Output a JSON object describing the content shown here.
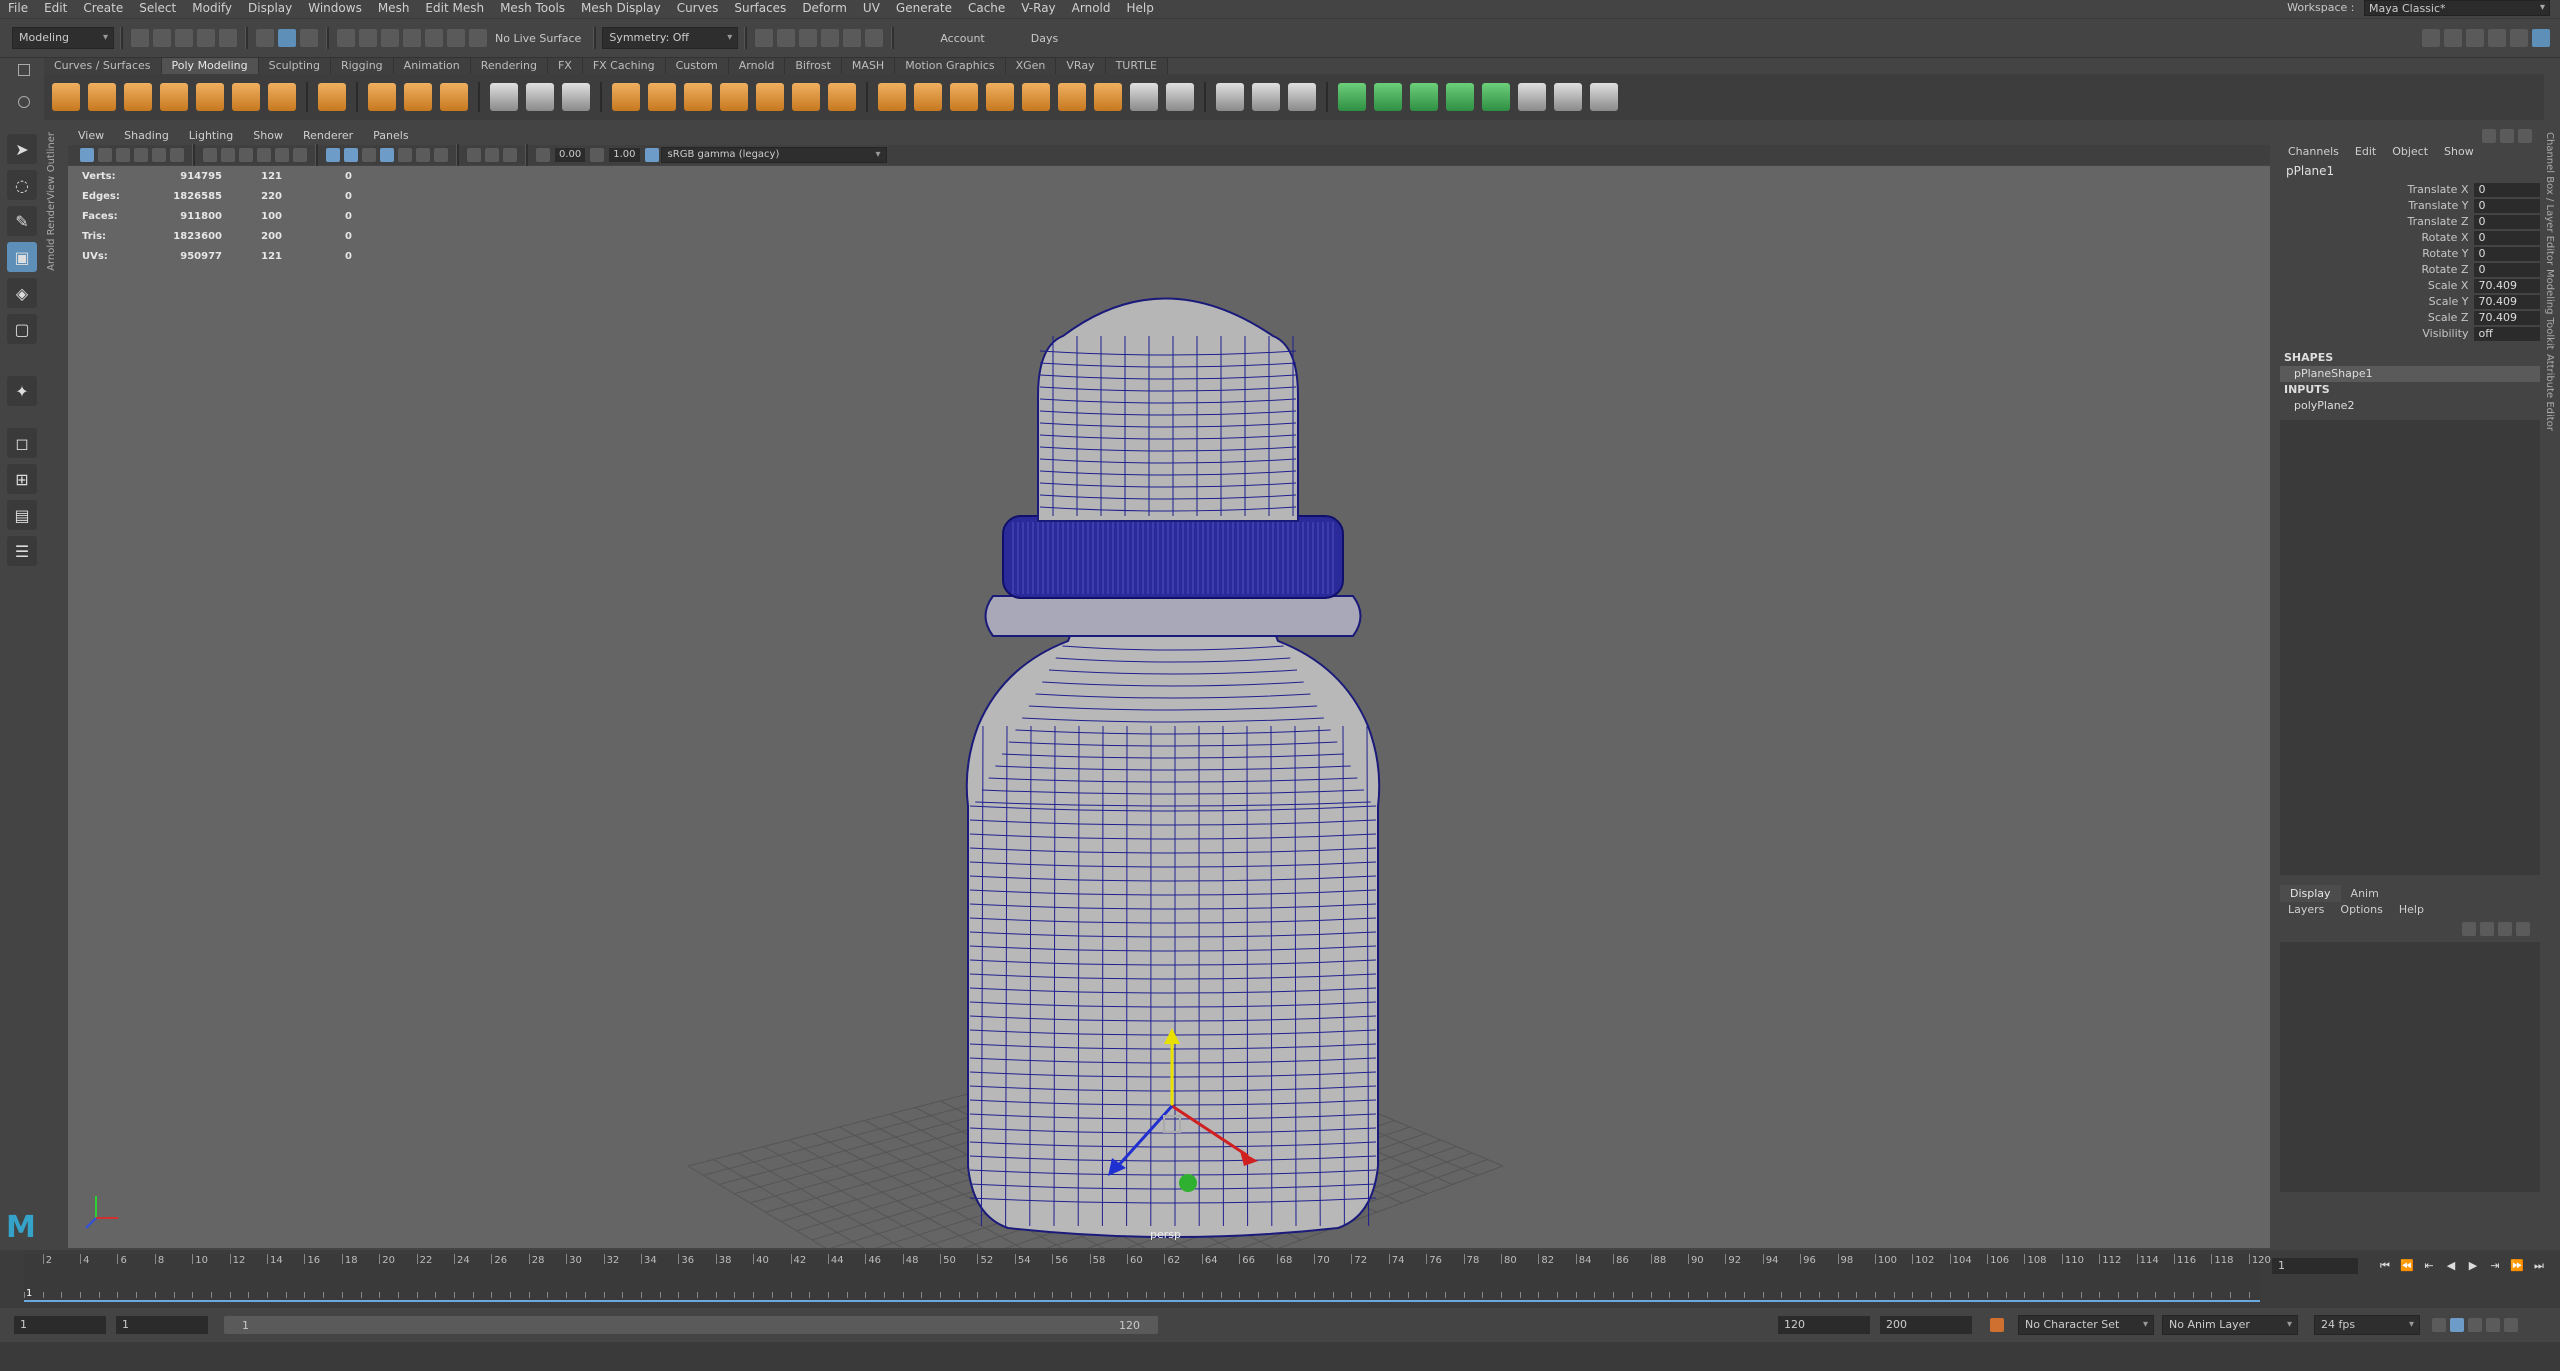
{
  "menubar": {
    "items": [
      "File",
      "Edit",
      "Create",
      "Select",
      "Modify",
      "Display",
      "Windows",
      "Mesh",
      "Edit Mesh",
      "Mesh Tools",
      "Mesh Display",
      "Curves",
      "Surfaces",
      "Deform",
      "UV",
      "Generate",
      "Cache",
      "V-Ray",
      "Arnold",
      "Help"
    ],
    "workspace_label": "Workspace :",
    "workspace_value": "Maya Classic*"
  },
  "statusline": {
    "mode": "Modeling",
    "live_surface": "No Live Surface",
    "symmetry": "Symmetry: Off",
    "account": "Account",
    "days": "Days"
  },
  "shelf": {
    "tabs": [
      "Curves / Surfaces",
      "Poly Modeling",
      "Sculpting",
      "Rigging",
      "Animation",
      "Rendering",
      "FX",
      "FX Caching",
      "Custom",
      "Arnold",
      "Bifrost",
      "MASH",
      "Motion Graphics",
      "XGen",
      "VRay",
      "TURTLE"
    ],
    "active_tab": "Poly Modeling"
  },
  "sidetabs": [
    "Outliner",
    "Arnold RenderView"
  ],
  "viewport": {
    "menu": [
      "View",
      "Shading",
      "Lighting",
      "Show",
      "Renderer",
      "Panels"
    ],
    "exposure": "0.00",
    "gamma": "1.00",
    "color_space": "sRGB gamma (legacy)",
    "camera": "persp",
    "hud": [
      {
        "label": "Verts:",
        "a": "914795",
        "b": "121",
        "c": "0"
      },
      {
        "label": "Edges:",
        "a": "1826585",
        "b": "220",
        "c": "0"
      },
      {
        "label": "Faces:",
        "a": "911800",
        "b": "100",
        "c": "0"
      },
      {
        "label": "Tris:",
        "a": "1823600",
        "b": "200",
        "c": "0"
      },
      {
        "label": "UVs:",
        "a": "950977",
        "b": "121",
        "c": "0"
      }
    ]
  },
  "channelbox": {
    "menu": [
      "Channels",
      "Edit",
      "Object",
      "Show"
    ],
    "object": "pPlane1",
    "attrs": [
      {
        "name": "Translate X",
        "value": "0"
      },
      {
        "name": "Translate Y",
        "value": "0"
      },
      {
        "name": "Translate Z",
        "value": "0"
      },
      {
        "name": "Rotate X",
        "value": "0"
      },
      {
        "name": "Rotate Y",
        "value": "0"
      },
      {
        "name": "Rotate Z",
        "value": "0"
      },
      {
        "name": "Scale X",
        "value": "70.409"
      },
      {
        "name": "Scale Y",
        "value": "70.409"
      },
      {
        "name": "Scale Z",
        "value": "70.409"
      },
      {
        "name": "Visibility",
        "value": "off"
      }
    ],
    "shapes_header": "SHAPES",
    "shape": "pPlaneShape1",
    "inputs_header": "INPUTS",
    "input": "polyPlane2"
  },
  "layer_editor": {
    "tabs": [
      "Display",
      "Anim"
    ],
    "menu": [
      "Layers",
      "Options",
      "Help"
    ]
  },
  "right_vertical_tabs": [
    "Channel Box / Layer Editor",
    "Modeling Toolkit",
    "Attribute Editor"
  ],
  "timeline": {
    "ticks": [
      2,
      4,
      6,
      8,
      10,
      12,
      14,
      16,
      18,
      20,
      22,
      24,
      26,
      28,
      30,
      32,
      34,
      36,
      38,
      40,
      42,
      44,
      46,
      48,
      50,
      52,
      54,
      56,
      58,
      60,
      62,
      64,
      66,
      68,
      70,
      72,
      74,
      76,
      78,
      80,
      82,
      84,
      86,
      88,
      90,
      92,
      94,
      96,
      98,
      100,
      102,
      104,
      106,
      108,
      110,
      112,
      114,
      116,
      118,
      120
    ],
    "current_frame": "1",
    "frame_field": "1"
  },
  "range": {
    "start": "1",
    "anim_start": "1",
    "slider_start": "1",
    "slider_end": "120",
    "end": "120",
    "anim_end": "200",
    "character_set": "No Character Set",
    "anim_layer": "No Anim Layer",
    "fps": "24 fps"
  }
}
